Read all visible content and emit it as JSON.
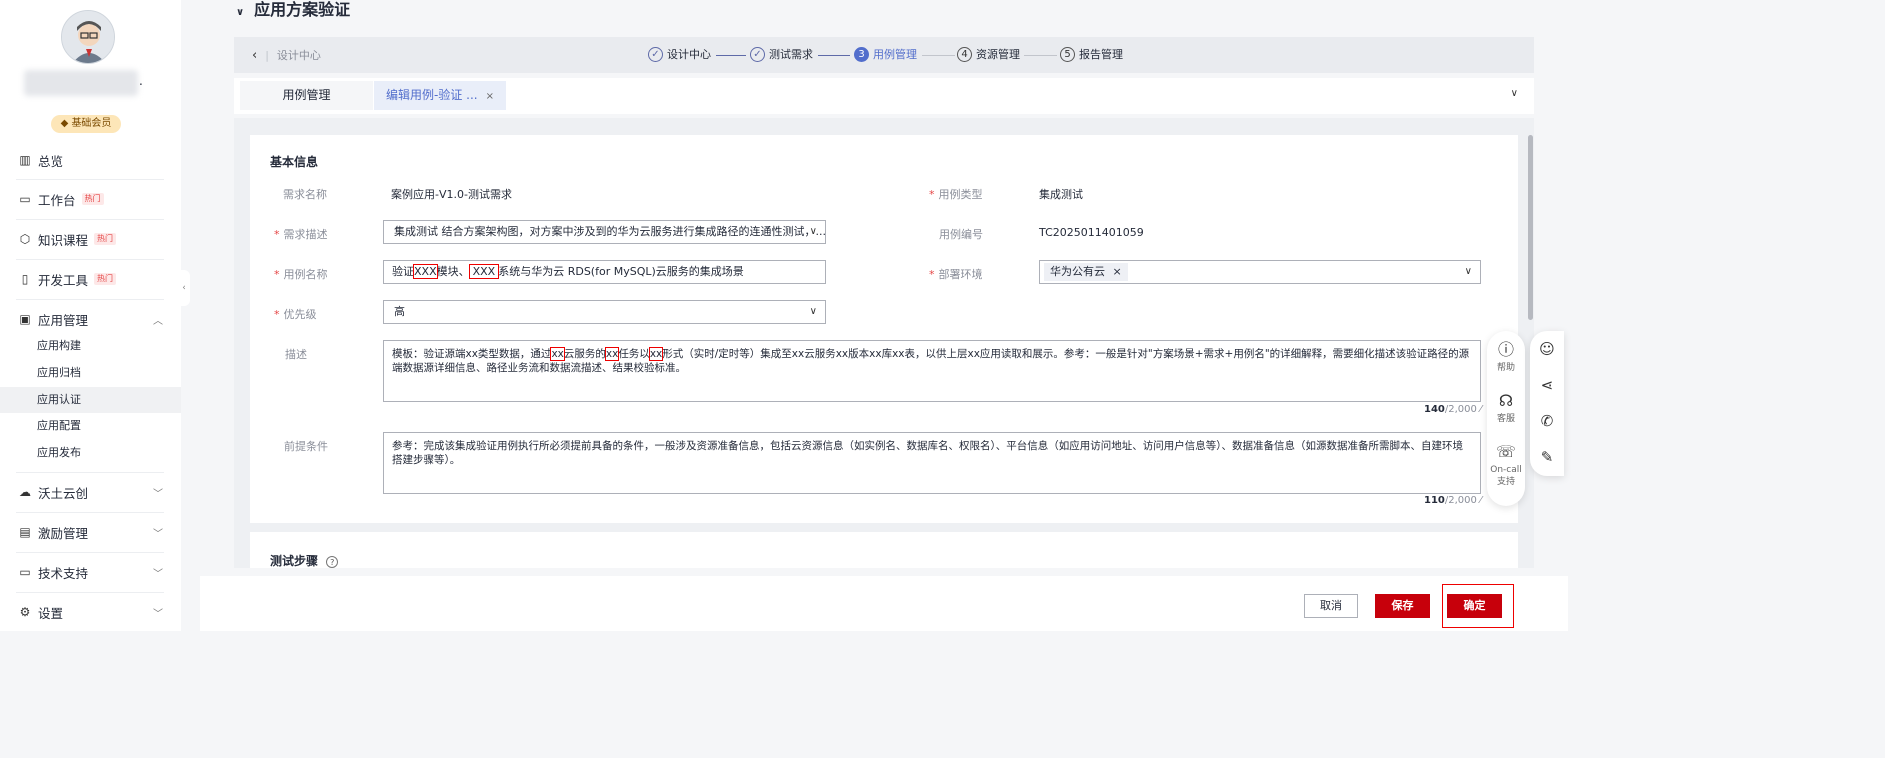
{
  "sidebar": {
    "member_badge": "基础会员",
    "name_suffix": ".",
    "items": [
      {
        "label": "总览",
        "icon": "chart-icon"
      },
      {
        "label": "工作台",
        "icon": "monitor-icon",
        "hot": "热门"
      },
      {
        "label": "知识课程",
        "icon": "cube-icon",
        "hot": "热门"
      },
      {
        "label": "开发工具",
        "icon": "phone-tool-icon",
        "hot": "热门"
      },
      {
        "label": "应用管理",
        "icon": "app-manage-icon"
      },
      {
        "label": "沃土云创",
        "icon": "cloud-icon"
      },
      {
        "label": "激励管理",
        "icon": "gift-icon"
      },
      {
        "label": "技术支持",
        "icon": "support-icon"
      },
      {
        "label": "设置",
        "icon": "gear-icon"
      }
    ],
    "sub_items": [
      "应用构建",
      "应用归档",
      "应用认证",
      "应用配置",
      "应用发布"
    ],
    "active_sub": "应用认证"
  },
  "page": {
    "title": "应用方案验证"
  },
  "stepbar": {
    "back_label": "设计中心",
    "steps": [
      {
        "num": "✓",
        "label": "设计中心",
        "state": "done"
      },
      {
        "num": "✓",
        "label": "测试需求",
        "state": "done"
      },
      {
        "num": "3",
        "label": "用例管理",
        "state": "active"
      },
      {
        "num": "4",
        "label": "资源管理",
        "state": "todo"
      },
      {
        "num": "5",
        "label": "报告管理",
        "state": "todo"
      }
    ]
  },
  "tabs": {
    "tab1": "用例管理",
    "tab2": "编辑用例-验证 ...",
    "close": "×"
  },
  "form": {
    "section_title": "基本信息",
    "req_name_label": "需求名称",
    "req_name_value": "案例应用-V1.0-测试需求",
    "case_type_label": "用例类型",
    "case_type_value": "集成测试",
    "req_desc_label": "需求描述",
    "req_desc_value": "集成测试 结合方案架构图，对方案中涉及到的华为云服务进行集成路径的连通性测试，...",
    "case_no_label": "用例编号",
    "case_no_value": "TC2025011401059",
    "case_name_label": "用例名称",
    "case_name_parts": [
      "验证",
      "XXX",
      "模块、",
      "XXX",
      "系统与华为云 RDS(for MySQL)云服务的集成场景"
    ],
    "env_label": "部署环境",
    "env_chip": "华为公有云",
    "priority_label": "优先级",
    "priority_value": "高",
    "desc_label": "描述",
    "desc_parts": [
      "模板：验证源端xx类型数据，通过",
      "xx",
      "云服务的",
      "xx",
      "任务以",
      "xx",
      "形式（实时/定时等）集成至xx云服务xx版本xx库xx表，以供上层xx应用读取和展示。参考：一般是针对\"方案场景+需求+用例名\"的详细解释，需要细化描述该验证路径的源端数据源详细信息、路径业务流和数据流描述、结果校验标准。"
    ],
    "desc_count": "140",
    "desc_max": "/2,000",
    "pre_label": "前提条件",
    "pre_value": "参考：完成该集成验证用例执行所必须提前具备的条件，一般涉及资源准备信息，包括云资源信息（如实例名、数据库名、权限名）、平台信息（如应用访问地址、访问用户信息等）、数据准备信息（如源数据准备所需脚本、自建环境搭建步骤等）。",
    "pre_count": "110",
    "pre_max": "/2,000",
    "steps_title": "测试步骤"
  },
  "float_tools": {
    "help": "帮助",
    "service": "客服",
    "oncall": "On-call\n支持"
  },
  "footer": {
    "cancel": "取消",
    "save": "保存",
    "ok": "确定"
  },
  "colors": {
    "brand_red": "#c7000b",
    "active_blue": "#526ecc",
    "highlight_red": "#e00000"
  }
}
